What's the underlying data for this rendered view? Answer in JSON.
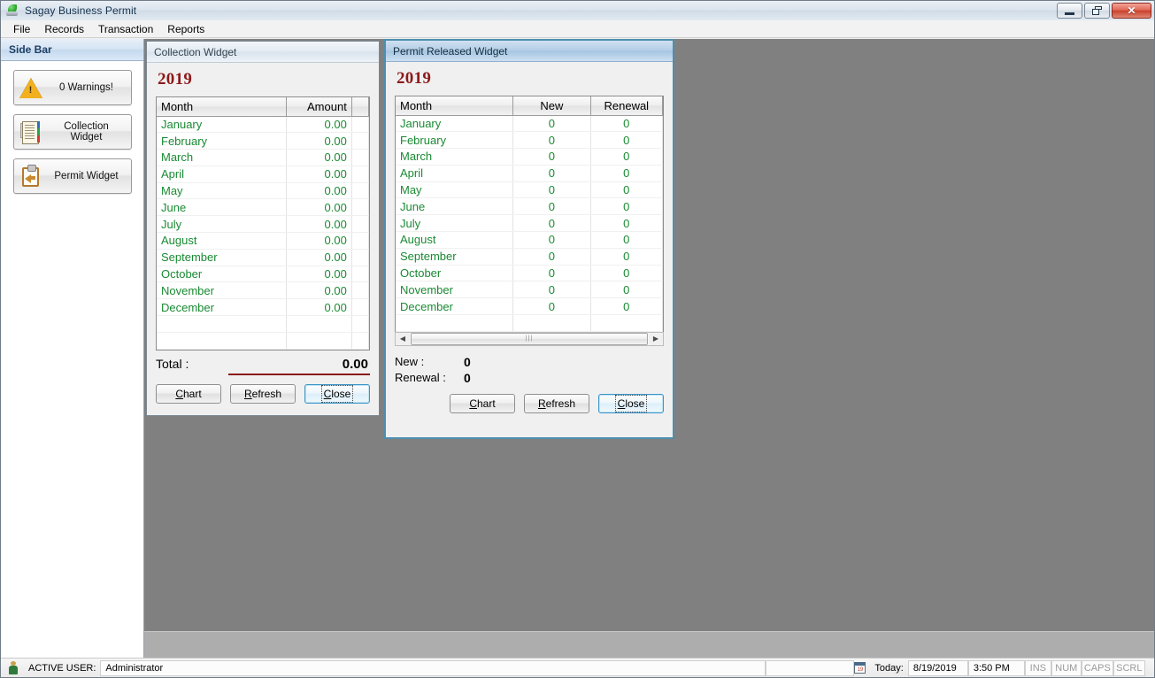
{
  "window": {
    "title": "Sagay Business Permit",
    "icon": "app-leaf-icon",
    "controls": {
      "minimize": "minimize",
      "restore": "restore",
      "close": "close"
    }
  },
  "menubar": {
    "items": [
      {
        "label": "File"
      },
      {
        "label": "Records"
      },
      {
        "label": "Transaction"
      },
      {
        "label": "Reports"
      }
    ]
  },
  "sidebar": {
    "header": "Side Bar",
    "buttons": [
      {
        "label": "0 Warnings!",
        "icon": "warning-triangle-icon"
      },
      {
        "label": "Collection Widget",
        "icon": "ledger-icon"
      },
      {
        "label": "Permit Widget",
        "icon": "clipboard-arrow-icon"
      }
    ]
  },
  "collection_widget": {
    "title": "Collection Widget",
    "year": "2019",
    "columns": [
      "Month",
      "Amount",
      ""
    ],
    "rows": [
      {
        "month": "January",
        "amount": "0.00"
      },
      {
        "month": "February",
        "amount": "0.00"
      },
      {
        "month": "March",
        "amount": "0.00"
      },
      {
        "month": "April",
        "amount": "0.00"
      },
      {
        "month": "May",
        "amount": "0.00"
      },
      {
        "month": "June",
        "amount": "0.00"
      },
      {
        "month": "July",
        "amount": "0.00"
      },
      {
        "month": "August",
        "amount": "0.00"
      },
      {
        "month": "September",
        "amount": "0.00"
      },
      {
        "month": "October",
        "amount": "0.00"
      },
      {
        "month": "November",
        "amount": "0.00"
      },
      {
        "month": "December",
        "amount": "0.00"
      }
    ],
    "total_label": "Total :",
    "total_value": "0.00",
    "buttons": [
      {
        "label": "Chart",
        "mnemonic": "C",
        "focused": false
      },
      {
        "label": "Refresh",
        "mnemonic": "R",
        "focused": false
      },
      {
        "label": "Close",
        "mnemonic": "C",
        "focused": true
      }
    ]
  },
  "permit_widget": {
    "title": "Permit Released Widget",
    "year": "2019",
    "columns": [
      "Month",
      "New",
      "Renewal"
    ],
    "rows": [
      {
        "month": "January",
        "new": "0",
        "renewal": "0"
      },
      {
        "month": "February",
        "new": "0",
        "renewal": "0"
      },
      {
        "month": "March",
        "new": "0",
        "renewal": "0"
      },
      {
        "month": "April",
        "new": "0",
        "renewal": "0"
      },
      {
        "month": "May",
        "new": "0",
        "renewal": "0"
      },
      {
        "month": "June",
        "new": "0",
        "renewal": "0"
      },
      {
        "month": "July",
        "new": "0",
        "renewal": "0"
      },
      {
        "month": "August",
        "new": "0",
        "renewal": "0"
      },
      {
        "month": "September",
        "new": "0",
        "renewal": "0"
      },
      {
        "month": "October",
        "new": "0",
        "renewal": "0"
      },
      {
        "month": "November",
        "new": "0",
        "renewal": "0"
      },
      {
        "month": "December",
        "new": "0",
        "renewal": "0"
      }
    ],
    "new_label": "New :",
    "new_value": "0",
    "renewal_label": "Renewal :",
    "renewal_value": "0",
    "buttons": [
      {
        "label": "Chart",
        "mnemonic": "C",
        "focused": false
      },
      {
        "label": "Refresh",
        "mnemonic": "R",
        "focused": false
      },
      {
        "label": "Close",
        "mnemonic": "C",
        "focused": true
      }
    ]
  },
  "statusbar": {
    "user_icon": "person-icon",
    "user_label": "ACTIVE USER:",
    "user_value": "Administrator",
    "calendar_icon": "calendar-icon",
    "today_label": "Today:",
    "date": "8/19/2019",
    "time": "3:50 PM",
    "indicators": [
      "INS",
      "NUM",
      "CAPS",
      "SCRL"
    ]
  },
  "colors": {
    "data_green": "#1a8a33",
    "year_red": "#8b1a1a",
    "mdi_gray": "#808080",
    "accent_blue": "#4d8fb0"
  }
}
